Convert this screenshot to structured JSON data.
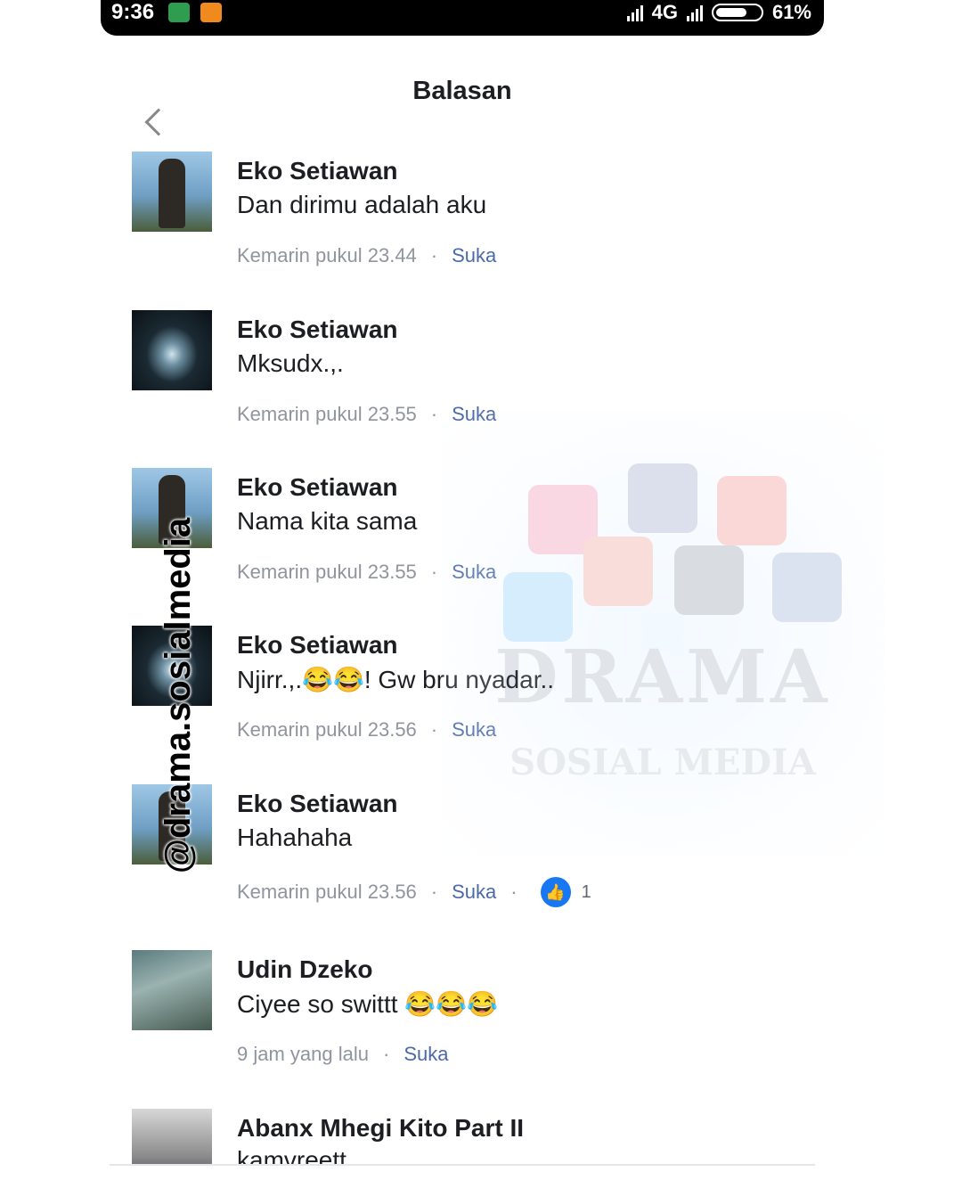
{
  "status_bar": {
    "time": "9:36",
    "network": "4G",
    "battery": "61%"
  },
  "header": {
    "title": "Balasan"
  },
  "comments": [
    {
      "name": "Eko Setiawan",
      "text": "Dan dirimu adalah aku",
      "time": "Kemarin pukul 23.44",
      "like": "Suka"
    },
    {
      "name": "Eko Setiawan",
      "text": "Mksudx.,.",
      "time": "Kemarin pukul 23.55",
      "like": "Suka"
    },
    {
      "name": "Eko Setiawan",
      "text": "Nama kita sama",
      "time": "Kemarin pukul 23.55",
      "like": "Suka"
    },
    {
      "name": "Eko Setiawan",
      "text": "Njirr.,.😂😂! Gw bru nyadar..",
      "time": "Kemarin pukul 23.56",
      "like": "Suka"
    },
    {
      "name": "Eko Setiawan",
      "text": "Hahahaha",
      "time": "Kemarin pukul 23.56",
      "like": "Suka",
      "reactions": "1"
    },
    {
      "name": "Udin Dzeko",
      "text": "Ciyee so swittt 😂😂😂",
      "time": "9 jam yang lalu",
      "like": "Suka"
    },
    {
      "name": "Abanx Mhegi Kito Part II",
      "text": "kamvreett",
      "time": "",
      "like": ""
    }
  ],
  "watermark": {
    "handle": "@drama.sosialmedia",
    "logo_main": "DRAMA",
    "logo_sub": "SOSIAL MEDIA"
  },
  "colors": {
    "link": "#4b6aa8",
    "meta": "#90949c",
    "like_badge": "#1877f2"
  }
}
